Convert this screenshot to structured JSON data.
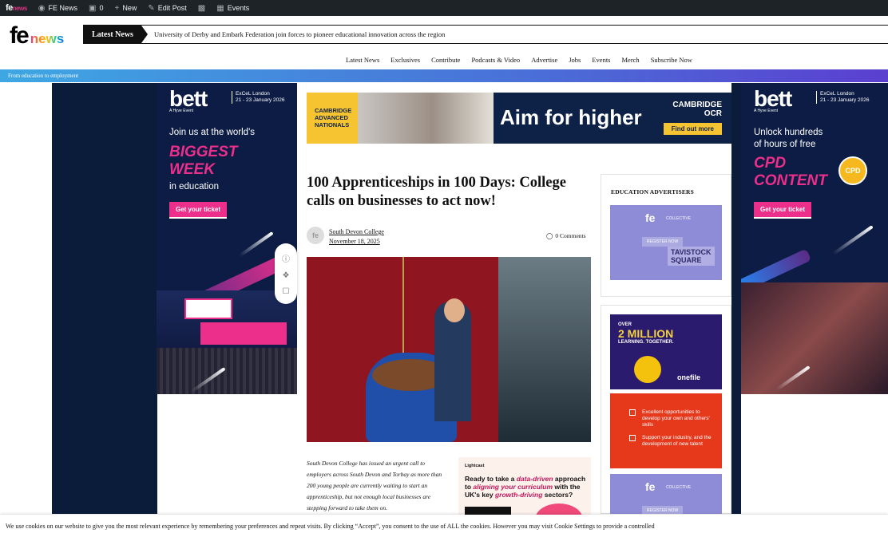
{
  "admin_bar": {
    "site_name": "FE News",
    "comments_count": "0",
    "new_label": "New",
    "edit_label": "Edit Post",
    "events_label": "Events"
  },
  "header": {
    "logo_fe": "fe",
    "logo_news": "news",
    "ticker_label": "Latest News",
    "ticker_text": "University of Derby and Embark Federation join forces to pioneer educational innovation across the region"
  },
  "nav": [
    "Latest News",
    "Exclusives",
    "Contribute",
    "Podcasts & Video",
    "Advertise",
    "Jobs",
    "Events",
    "Merch",
    "Subscribe Now"
  ],
  "strip_text": "From education to employment",
  "bett_left": {
    "brand": "bett",
    "hyve": "A Hyve Event",
    "venue_1": "ExCeL London",
    "venue_2": "21 - 23 January 2026",
    "line_1": "Join us at the world's",
    "big_1": "BIGGEST",
    "big_2": "WEEK",
    "line_2": "in education",
    "cta": "Get your ticket"
  },
  "bett_right": {
    "brand": "bett",
    "hyve": "A Hyve Event",
    "venue_1": "ExCeL London",
    "venue_2": "21 - 23 January 2026",
    "line_1": "Unlock hundreds",
    "line_1b": "of hours of free",
    "big_1": "CPD",
    "big_2": "CONTENT",
    "badge": "CPD",
    "cta": "Get your ticket"
  },
  "banner": {
    "left_1": "CAMBRIDGE",
    "left_2": "ADVANCED",
    "left_3": "NATIONALS",
    "headline": "Aim for higher",
    "org_1": "CAMBRIDGE",
    "org_2": "OCR",
    "button": "Find out more"
  },
  "article": {
    "title": "100 Apprenticeships in 100 Days: College calls on businesses to act now!",
    "author": "South Devon College",
    "date": "November 18, 2025",
    "comments": "0 Comments",
    "excerpt": "South Devon College has issued an urgent call to employers across South Devon and Torbay as more than 200 young people are currently waiting to start an apprenticeship, but not enough local businesses are stepping forward to take them on."
  },
  "lightcast": {
    "brand": "Lightcast",
    "text_1": "Ready to take a ",
    "text_em": "data-driven",
    "text_2": " approach to ",
    "text_em2": "aligning your curriculum",
    "text_3": " with the UK's key ",
    "text_em3": "growth-driving",
    "text_4": " sectors?"
  },
  "sidebar": {
    "heading": "EDUCATION ADVERTISERS",
    "collective": "COLLECTIVE",
    "register": "REGISTER NOW",
    "sign_1": "TAVISTOCK",
    "sign_2": "SQUARE"
  },
  "onefile": {
    "over": "OVER",
    "million": "2 MILLION",
    "tag": "LEARNING. TOGETHER.",
    "brand": "onefile"
  },
  "opportunities": {
    "item_1": "Excellent opportunities to develop your own and others' skills",
    "item_2": "Support your industry, and the development of new talent"
  },
  "cookie_text": "We use cookies on our website to give you the most relevant experience by remembering your preferences and repeat visits. By clicking “Accept”, you consent to the use of ALL the cookies. However you may visit Cookie Settings to provide a controlled"
}
